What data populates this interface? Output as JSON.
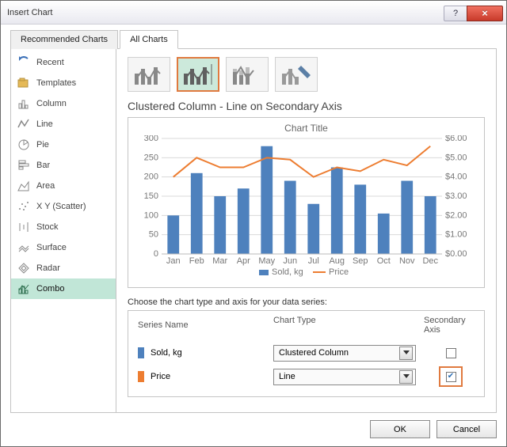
{
  "window": {
    "title": "Insert Chart"
  },
  "tabs": {
    "recommended": "Recommended Charts",
    "all": "All Charts"
  },
  "sidebar": {
    "items": [
      {
        "label": "Recent",
        "icon": "recent"
      },
      {
        "label": "Templates",
        "icon": "templates"
      },
      {
        "label": "Column",
        "icon": "column"
      },
      {
        "label": "Line",
        "icon": "line"
      },
      {
        "label": "Pie",
        "icon": "pie"
      },
      {
        "label": "Bar",
        "icon": "bar"
      },
      {
        "label": "Area",
        "icon": "area"
      },
      {
        "label": "X Y (Scatter)",
        "icon": "scatter"
      },
      {
        "label": "Stock",
        "icon": "stock"
      },
      {
        "label": "Surface",
        "icon": "surface"
      },
      {
        "label": "Radar",
        "icon": "radar"
      },
      {
        "label": "Combo",
        "icon": "combo"
      }
    ],
    "active_index": 11
  },
  "subtype_title": "Clustered Column - Line on Secondary Axis",
  "preview_chart_title": "Chart Title",
  "series_caption": "Choose the chart type and axis for your data series:",
  "series_headers": {
    "name": "Series Name",
    "type": "Chart Type",
    "axis": "Secondary Axis"
  },
  "series": [
    {
      "name": "Sold, kg",
      "chart_type": "Clustered Column",
      "secondary_axis": false,
      "color": "#4e81bd"
    },
    {
      "name": "Price",
      "chart_type": "Line",
      "secondary_axis": true,
      "color": "#ed7d31"
    }
  ],
  "series_highlight_index": 1,
  "buttons": {
    "ok": "OK",
    "cancel": "Cancel"
  },
  "chart_data": {
    "type": "combo",
    "categories": [
      "Jan",
      "Feb",
      "Mar",
      "Apr",
      "May",
      "Jun",
      "Jul",
      "Aug",
      "Sep",
      "Oct",
      "Nov",
      "Dec"
    ],
    "series": [
      {
        "name": "Sold, kg",
        "type": "bar",
        "axis": "primary",
        "color": "#4e81bd",
        "values": [
          100,
          210,
          150,
          170,
          280,
          190,
          130,
          225,
          180,
          105,
          190,
          150
        ]
      },
      {
        "name": "Price",
        "type": "line",
        "axis": "secondary",
        "color": "#ed7d31",
        "values": [
          4.0,
          5.0,
          4.5,
          4.5,
          5.0,
          4.9,
          4.0,
          4.5,
          4.3,
          4.9,
          4.6,
          5.6
        ]
      }
    ],
    "title": "Chart Title",
    "xlabel": "",
    "y1label": "",
    "y2label": "",
    "y1": {
      "min": 0,
      "max": 300,
      "step": 50
    },
    "y2": {
      "min": 0,
      "max": 6,
      "step": 1,
      "format": "$0.00"
    },
    "legend": [
      "Sold, kg",
      "Price"
    ]
  }
}
